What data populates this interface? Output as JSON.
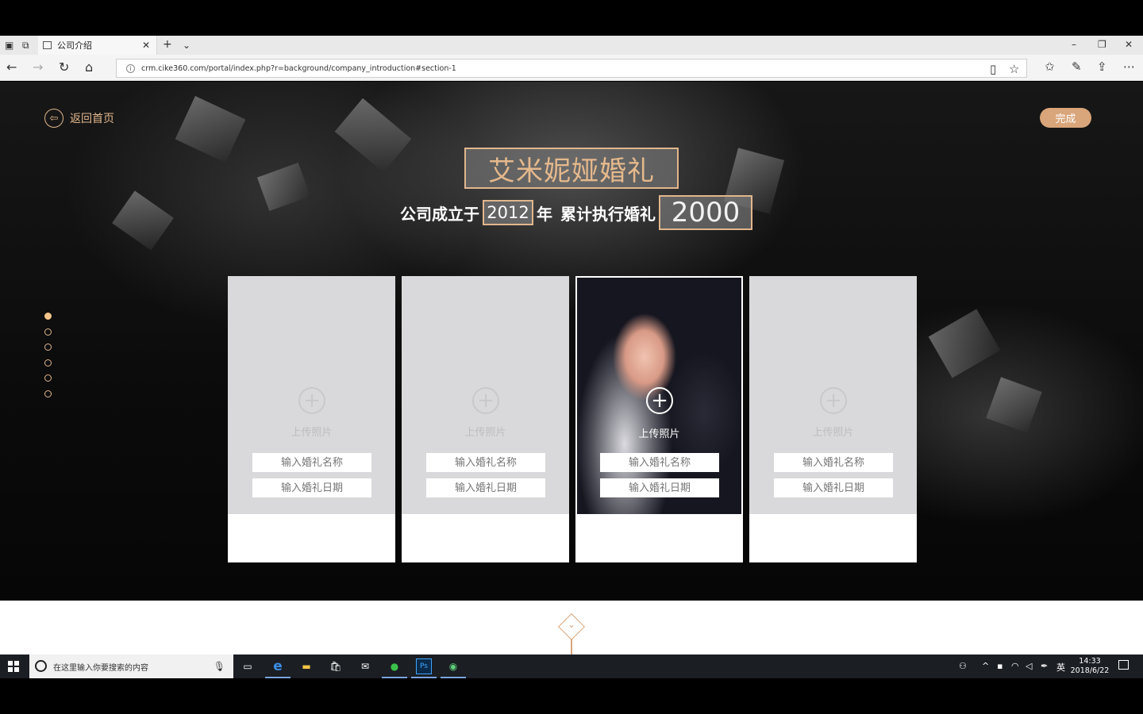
{
  "browser": {
    "tab_title": "公司介绍",
    "url": "crm.cike360.com/portal/index.php?r=background/company_introduction#section-1"
  },
  "page": {
    "back_label": "返回首页",
    "done_label": "完成",
    "company_name": "艾米妮娅婚礼",
    "founded_prefix": "公司成立于",
    "founded_year": "2012",
    "founded_suffix": "年",
    "weddings_prefix": "累计执行婚礼",
    "weddings_count": "2000",
    "section_dots": 6,
    "active_section": 1,
    "cards": [
      {
        "upload_label": "上传照片",
        "name_placeholder": "输入婚礼名称",
        "date_placeholder": "输入婚礼日期",
        "has_photo": false
      },
      {
        "upload_label": "上传照片",
        "name_placeholder": "输入婚礼名称",
        "date_placeholder": "输入婚礼日期",
        "has_photo": false
      },
      {
        "upload_label": "上传照片",
        "name_placeholder": "输入婚礼名称",
        "date_placeholder": "输入婚礼日期",
        "has_photo": true
      },
      {
        "upload_label": "上传照片",
        "name_placeholder": "输入婚礼名称",
        "date_placeholder": "输入婚礼日期",
        "has_photo": false
      }
    ]
  },
  "taskbar": {
    "search_placeholder": "在这里输入你要搜索的内容",
    "time": "14:33",
    "date": "2018/6/22",
    "ime": "英"
  },
  "colors": {
    "accent": "#e1b68c",
    "done_button": "#d9a57a"
  }
}
